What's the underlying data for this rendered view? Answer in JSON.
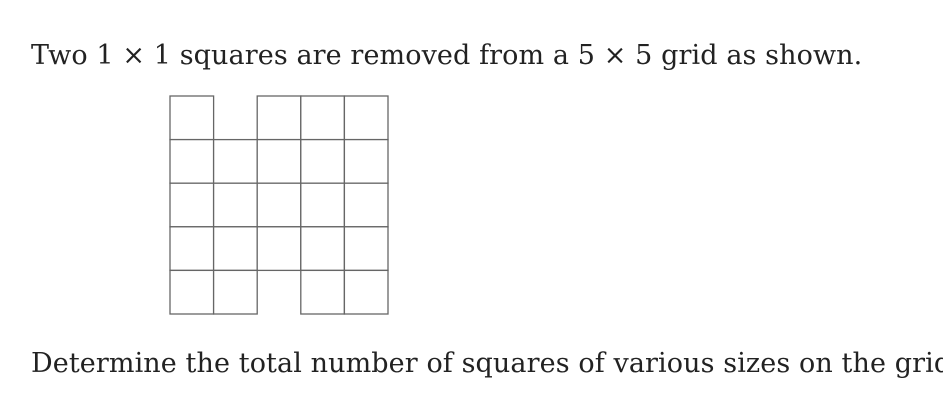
{
  "problem": {
    "intro_text": "Two 1 × 1 squares are removed from a 5 × 5 grid as shown.",
    "question_text": "Determine the total number of squares of various sizes on the grid."
  },
  "grid": {
    "rows": 5,
    "cols": 5,
    "removed_cells": [
      {
        "row": 0,
        "col": 1
      },
      {
        "row": 4,
        "col": 2
      }
    ],
    "line_color": "#666666",
    "background_color": "#ffffff"
  }
}
